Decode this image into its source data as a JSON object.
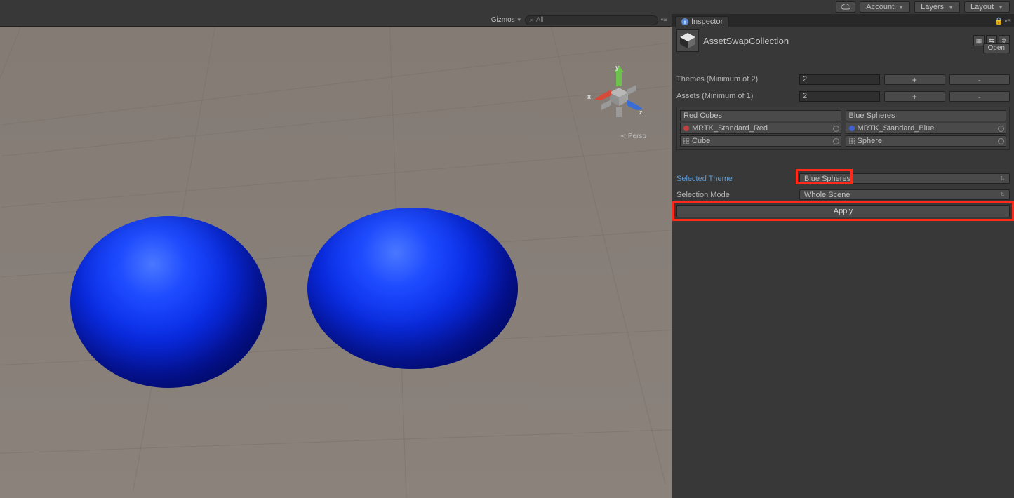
{
  "toolbar": {
    "account": "Account",
    "layers": "Layers",
    "layout": "Layout"
  },
  "scene": {
    "gizmos_label": "Gizmos",
    "search_placeholder": "All",
    "persp_label": "Persp",
    "axes": {
      "x": "x",
      "y": "y",
      "z": "z"
    }
  },
  "inspector": {
    "tab": "Inspector",
    "asset_name": "AssetSwapCollection",
    "open": "Open",
    "themes_label": "Themes (Minimum of 2)",
    "themes_value": "2",
    "assets_label": "Assets (Minimum of 1)",
    "assets_value": "2",
    "plus": "+",
    "minus": "-",
    "columns": [
      {
        "title": "Red Cubes",
        "mat": "MRTK_Standard_Red",
        "mesh": "Cube"
      },
      {
        "title": "Blue Spheres",
        "mat": "MRTK_Standard_Blue",
        "mesh": "Sphere"
      }
    ],
    "selected_theme_label": "Selected Theme",
    "selected_theme_value": "Blue Spheres",
    "selection_mode_label": "Selection Mode",
    "selection_mode_value": "Whole Scene",
    "apply": "Apply"
  }
}
